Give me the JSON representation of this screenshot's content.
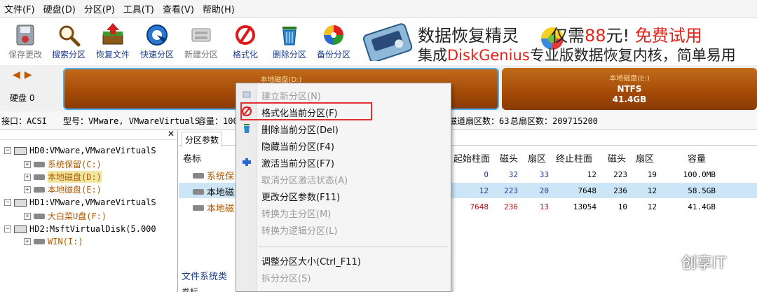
{
  "menubar": {
    "items": [
      {
        "label": "文件(F)"
      },
      {
        "label": "硬盘(D)"
      },
      {
        "label": "分区(P)"
      },
      {
        "label": "工具(T)"
      },
      {
        "label": "查看(V)"
      },
      {
        "label": "帮助(H)"
      }
    ]
  },
  "toolbar": {
    "buttons": [
      {
        "label": "保存更改",
        "icon": "save-changes-icon",
        "enabled": false
      },
      {
        "label": "搜索分区",
        "icon": "search-partition-icon",
        "enabled": true
      },
      {
        "label": "恢复文件",
        "icon": "recover-files-icon",
        "enabled": true
      },
      {
        "label": "快速分区",
        "icon": "quick-partition-icon",
        "enabled": true
      },
      {
        "label": "新建分区",
        "icon": "new-partition-icon",
        "enabled": false
      },
      {
        "label": "格式化",
        "icon": "format-icon",
        "enabled": true
      },
      {
        "label": "删除分区",
        "icon": "delete-partition-icon",
        "enabled": true
      },
      {
        "label": "备份分区",
        "icon": "backup-partition-icon",
        "enabled": true
      }
    ]
  },
  "banner": {
    "line1_a": "数据恢复精灵",
    "line1_b": "仅需",
    "line1_price": "88",
    "line1_c": "元!",
    "line1_free": "免费试用",
    "line2_a": "集成",
    "line2_dg": "DiskGenius",
    "line2_b": "专业版数据恢复内核，简单易用"
  },
  "diskbar": {
    "disk_label": "硬盘 0",
    "partition_d": {
      "name": "本地磁盘(D:)"
    },
    "partition_e": {
      "name": "本地磁盘(E:)",
      "fs": "NTFS",
      "size": "41.4GB"
    }
  },
  "infoline": {
    "iface": "接口：ACSI",
    "model": "型号：VMware, VMwareVirtualS",
    "capacity": "容量：100",
    "sectors_per_track": "磁道扇区数：63",
    "total_sectors": "总扇区数：209715200"
  },
  "tree": {
    "nodes": [
      {
        "label": "HD0:VMware,VMwareVirtualS"
      },
      {
        "label": "系统保留(C:)"
      },
      {
        "label": "本地磁盘(D:)"
      },
      {
        "label": "本地磁盘(E:)"
      },
      {
        "label": "HD1:VMware,VMwareVirtualS"
      },
      {
        "label": "大白菜U盘(F:)"
      },
      {
        "label": "HD2:MsftVirtualDisk(5.000"
      },
      {
        "label": "WIN(I:)"
      }
    ]
  },
  "rightpane": {
    "tab_label": "分区参数",
    "headers": {
      "volume": "卷标",
      "start_cyl": "起始柱面",
      "head1": "磁头",
      "sector1": "扇区",
      "end_cyl": "终止柱面",
      "head2": "磁头",
      "sector2": "扇区",
      "capacity": "容量"
    },
    "rows": [
      {
        "volume": "系统保",
        "start_cyl": "0",
        "head1": "32",
        "sector1": "33",
        "end_cyl": "12",
        "head2": "223",
        "sector2": "19",
        "capacity": "100.0MB"
      },
      {
        "volume": "本地磁",
        "start_cyl": "12",
        "head1": "223",
        "sector1": "20",
        "end_cyl": "7648",
        "head2": "236",
        "sector2": "12",
        "capacity": "58.5GB"
      },
      {
        "volume": "本地磁",
        "start_cyl": "7648",
        "head1": "236",
        "sector1": "13",
        "end_cyl": "13054",
        "head2": "10",
        "sector2": "12",
        "capacity": "41.4GB"
      }
    ],
    "bottom_label": "文件系统类",
    "bottom_label2": "卷标"
  },
  "context_menu": {
    "items": [
      {
        "label": "建立新分区(N)",
        "enabled": false,
        "icon": "new-partition-icon"
      },
      {
        "label": "格式化当前分区(F)",
        "enabled": true,
        "icon": "format-icon",
        "highlighted": true
      },
      {
        "label": "删除当前分区(Del)",
        "enabled": true,
        "icon": "delete-icon"
      },
      {
        "label": "隐藏当前分区(F4)",
        "enabled": true,
        "icon": ""
      },
      {
        "label": "激活当前分区(F7)",
        "enabled": true,
        "icon": "activate-icon"
      },
      {
        "label": "取消分区激活状态(A)",
        "enabled": false,
        "icon": ""
      },
      {
        "label": "更改分区参数(F11)",
        "enabled": true,
        "icon": ""
      },
      {
        "label": "转换为主分区(M)",
        "enabled": false,
        "icon": ""
      },
      {
        "label": "转换为逻辑分区(L)",
        "enabled": false,
        "icon": ""
      },
      {
        "label": "调整分区大小(Ctrl_F11)",
        "enabled": true,
        "icon": ""
      },
      {
        "label": "拆分分区(S)",
        "enabled": false,
        "icon": ""
      }
    ]
  },
  "watermark": {
    "text": "创享IT"
  },
  "colors": {
    "partition": "#a44a08",
    "selection": "#cde6f7",
    "highlight_border": "#e23030",
    "accent_red": "#e2231a",
    "label_blue": "#1a3a8a"
  }
}
